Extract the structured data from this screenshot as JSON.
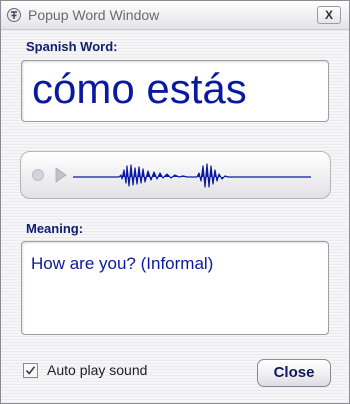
{
  "window": {
    "title": "Popup Word Window",
    "close_glyph": "X"
  },
  "word_section": {
    "label": "Spanish Word:",
    "word": "cómo estás"
  },
  "sound_player": {
    "play_icon": "play-icon",
    "waveform_color": "#0a1aa0"
  },
  "meaning_section": {
    "label": "Meaning:",
    "text": "How are you? (Informal)"
  },
  "options": {
    "auto_play_label": "Auto play sound",
    "auto_play_checked": true
  },
  "buttons": {
    "close_label": "Close"
  },
  "colors": {
    "accent": "#0a1aa0",
    "label": "#102070"
  }
}
